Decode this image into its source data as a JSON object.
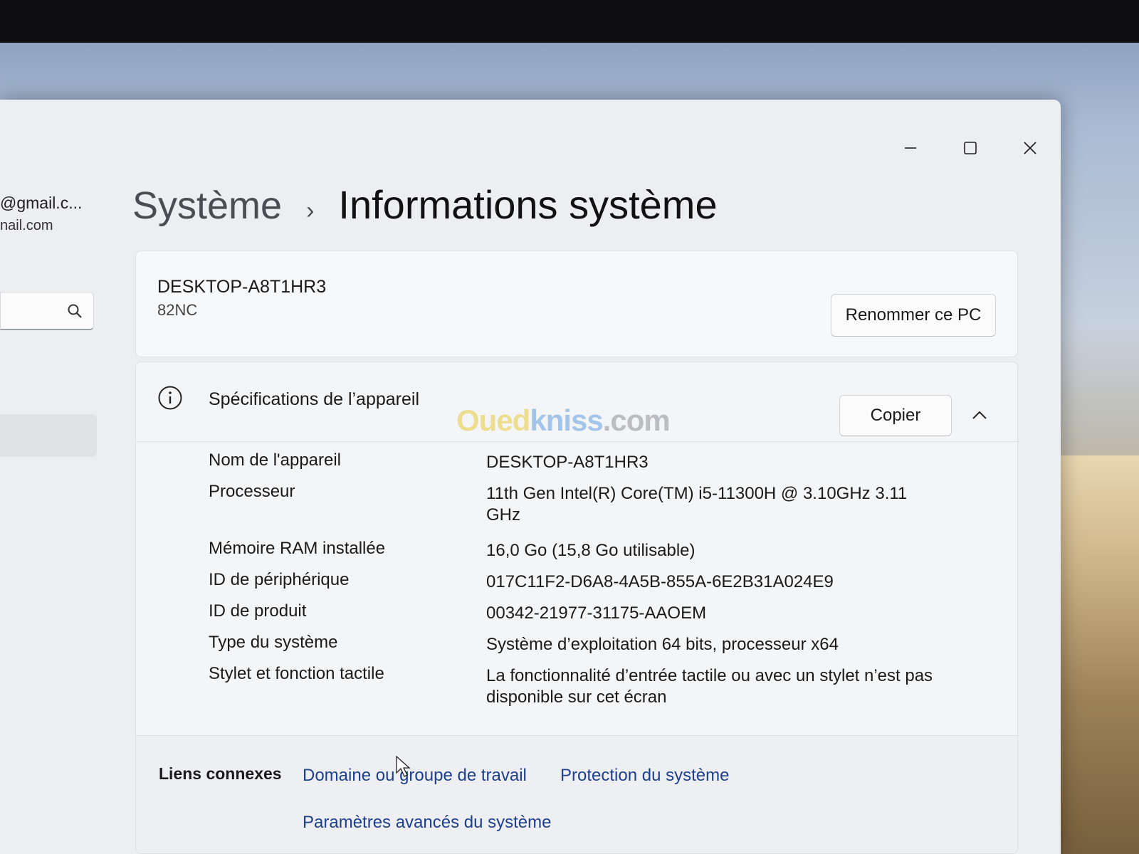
{
  "account": {
    "email_line1": "@gmail.c...",
    "email_line2": "nail.com"
  },
  "breadcrumb": {
    "parent": "Système",
    "separator": "›",
    "current": "Informations système"
  },
  "device": {
    "name": "DESKTOP-A8T1HR3",
    "model": "82NC",
    "rename_button": "Renommer ce PC"
  },
  "specs": {
    "title": "Spécifications de l’appareil",
    "copy_button": "Copier",
    "watermark": [
      "Oued",
      "kniss",
      ".com"
    ],
    "rows": [
      {
        "label": "Nom de l'appareil",
        "value": "DESKTOP-A8T1HR3"
      },
      {
        "label": "Processeur",
        "value": "11th Gen Intel(R) Core(TM) i5-11300H @ 3.10GHz   3.11 GHz"
      },
      {
        "label": "Mémoire RAM installée",
        "value": "16,0 Go (15,8 Go utilisable)"
      },
      {
        "label": "ID de périphérique",
        "value": "017C11F2-D6A8-4A5B-855A-6E2B31A024E9"
      },
      {
        "label": "ID de produit",
        "value": "00342-21977-31175-AAOEM"
      },
      {
        "label": "Type du système",
        "value": "Système d’exploitation 64 bits, processeur x64"
      },
      {
        "label": "Stylet et fonction tactile",
        "value": "La fonctionnalité d’entrée tactile ou avec un stylet n’est pas disponible sur cet écran"
      }
    ]
  },
  "related": {
    "label": "Liens connexes",
    "links": [
      "Domaine ou groupe de travail",
      "Protection du système",
      "Paramètres avancés du système"
    ]
  }
}
